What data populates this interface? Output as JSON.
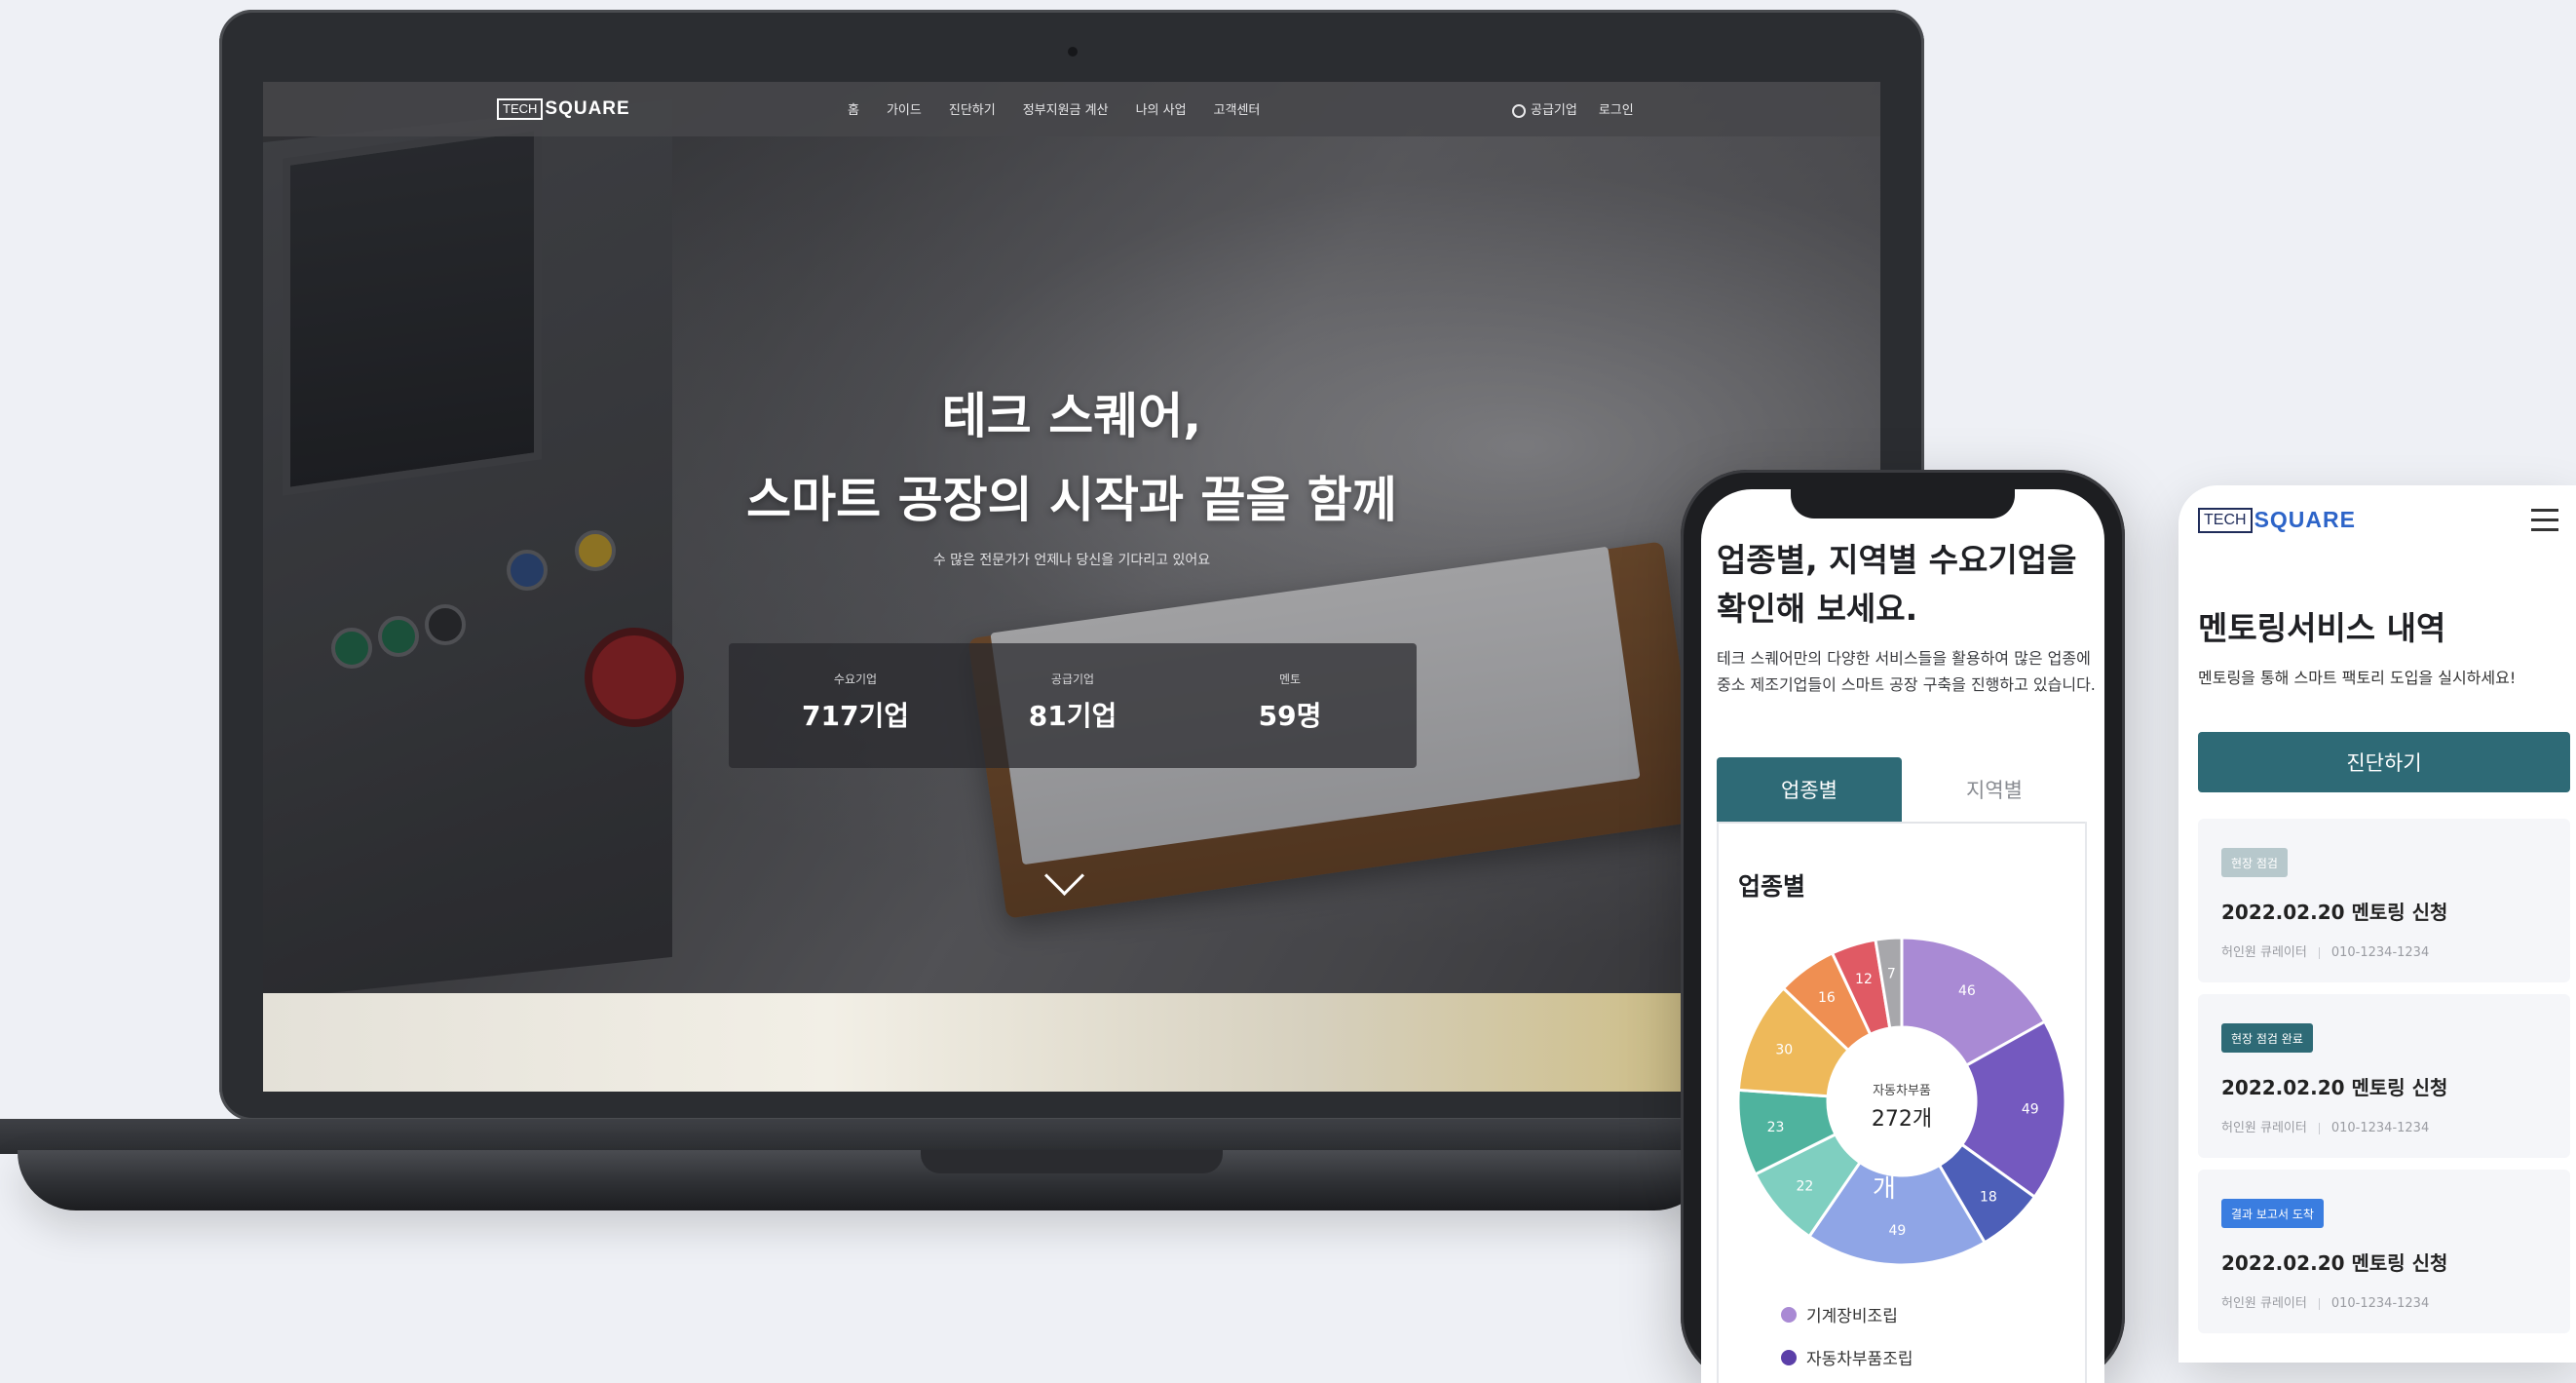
{
  "laptop": {
    "nav": {
      "logo_tech": "TECH",
      "logo_square": "SQUARE",
      "menu": [
        "홈",
        "가이드",
        "진단하기",
        "정부지원금 계산",
        "나의 사업",
        "고객센터"
      ],
      "right": {
        "supplier": "공급기업",
        "login": "로그인"
      }
    },
    "hero": {
      "title_line1": "테크 스퀘어,",
      "title_line2": "스마트 공장의 시작과 끝을 함께",
      "subtitle": "수 많은 전문가가 언제나 당신을 기다리고 있어요"
    },
    "stats": [
      {
        "label": "수요기업",
        "value": "717기업"
      },
      {
        "label": "공급기업",
        "value": "81기업"
      },
      {
        "label": "멘토",
        "value": "59명"
      }
    ]
  },
  "phone1": {
    "title": "업종별, 지역별 수요기업을 확인해 보세요.",
    "description": "테크 스퀘어만의 다양한 서비스들을 활용하여 많은 업종에 중소 제조기업들이 스마트 공장 구축을 진행하고 있습니다.",
    "tabs": {
      "active": "업종별",
      "inactive": "지역별"
    },
    "card_title": "업종별",
    "chart_data": {
      "type": "pie",
      "center_label": "자동차부품",
      "center_value": "272개",
      "slices": [
        {
          "label": "46",
          "value": 46,
          "color": "#a98ad4"
        },
        {
          "label": "49",
          "value": 49,
          "color": "#7459bf"
        },
        {
          "label": "18",
          "value": 18,
          "color": "#4d5fb8"
        },
        {
          "label": "49",
          "value": 49,
          "color": "#8fa5e6"
        },
        {
          "label": "22",
          "value": 22,
          "color": "#7fcfc0"
        },
        {
          "label": "23",
          "value": 23,
          "color": "#4fb39e"
        },
        {
          "label": "30",
          "value": 30,
          "color": "#eeb95a"
        },
        {
          "label": "16",
          "value": 16,
          "color": "#ef8f52"
        },
        {
          "label": "12",
          "value": 12,
          "color": "#e05a64"
        },
        {
          "label": "7",
          "value": 7,
          "color": "#a7a7ab"
        }
      ],
      "inner_overlay_text": "개"
    },
    "legend": [
      {
        "label": "기계장비조립",
        "color": "#a98ad4"
      },
      {
        "label": "자동차부품조립",
        "color": "#5b3fa8"
      }
    ]
  },
  "phone2": {
    "logo_tech": "TECH",
    "logo_square": "SQUARE",
    "title": "멘토링서비스 내역",
    "description": "멘토링을 통해 스마트 팩토리 도입을 실시하세요!",
    "cta": "진단하기",
    "items": [
      {
        "badge": "현장 점검",
        "badge_color": "#b7c8cc",
        "title": "2022.02.20 멘토링 신청",
        "name": "허인원 큐레이터",
        "phone": "010-1234-1234"
      },
      {
        "badge": "현장 점검 완료",
        "badge_color": "#2e6a76",
        "title": "2022.02.20 멘토링 신청",
        "name": "허인원 큐레이터",
        "phone": "010-1234-1234"
      },
      {
        "badge": "결과 보고서 도착",
        "badge_color": "#3a7de0",
        "title": "2022.02.20 멘토링 신청",
        "name": "허인원 큐레이터",
        "phone": "010-1234-1234"
      }
    ]
  }
}
